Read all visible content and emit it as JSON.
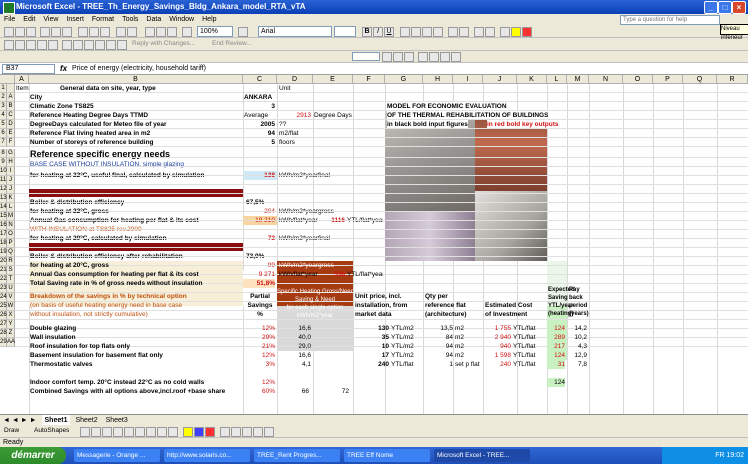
{
  "window": {
    "title": "Microsoft Excel - TREE_Th_Energy_Savings_Bldg_Ankara_model_RTA_vTA",
    "ask_placeholder": "Type a question for help",
    "tooltip": "Niveau inférieur"
  },
  "menu": [
    "File",
    "Edit",
    "View",
    "Insert",
    "Format",
    "Tools",
    "Data",
    "Window",
    "Help"
  ],
  "toolbar": {
    "zoom": "100%",
    "font": "Arial",
    "reply_label": "Reply with Changes...",
    "end_review": "End Review..."
  },
  "formula_bar": {
    "cell_ref": "B37",
    "fx": "fx",
    "content": "Price of energy (electricity, household tariff)"
  },
  "columns": [
    "A",
    "B",
    "C",
    "D",
    "E",
    "F",
    "G",
    "H",
    "I",
    "J",
    "K",
    "L",
    "M",
    "N",
    "O",
    "P",
    "Q",
    "R"
  ],
  "rows": [
    {
      "n": "1",
      "l": ""
    },
    {
      "n": "2",
      "l": "A"
    },
    {
      "n": "3",
      "l": "B"
    },
    {
      "n": "4",
      "l": "C"
    },
    {
      "n": "5",
      "l": "D"
    },
    {
      "n": "6",
      "l": "E"
    },
    {
      "n": "7",
      "l": "F"
    },
    {
      "n": "8",
      "l": "G"
    },
    {
      "n": "9",
      "l": "H"
    },
    {
      "n": "10",
      "l": "I"
    },
    {
      "n": "11",
      "l": "J"
    },
    {
      "n": "12",
      "l": "J"
    },
    {
      "n": "13",
      "l": "K"
    },
    {
      "n": "14",
      "l": "L"
    },
    {
      "n": "15",
      "l": "M"
    },
    {
      "n": "16",
      "l": "N"
    },
    {
      "n": "17",
      "l": "O"
    },
    {
      "n": "18",
      "l": "P"
    },
    {
      "n": "19",
      "l": "Q"
    },
    {
      "n": "20",
      "l": "R"
    },
    {
      "n": "21",
      "l": "S"
    },
    {
      "n": "22",
      "l": "T"
    },
    {
      "n": "23",
      "l": "U"
    },
    {
      "n": "24",
      "l": "V"
    },
    {
      "n": "25",
      "l": "W"
    },
    {
      "n": "26",
      "l": "X"
    },
    {
      "n": "27",
      "l": "Y"
    },
    {
      "n": "28",
      "l": "Z"
    },
    {
      "n": "29",
      "l": "AA"
    }
  ],
  "sheet": {
    "r1": {
      "item": "Item",
      "general": "General data on site, year, type",
      "unit": "Unit"
    },
    "r2": {
      "label": "City",
      "value": "ANKARA"
    },
    "r3": {
      "label": "Climatic Zone TS825",
      "value": "3"
    },
    "r4": {
      "label": "Reference Heating Degree Days TTMD",
      "value": "Average",
      "value2": "2913",
      "unit": "Degree Days"
    },
    "r5": {
      "label": "DegreeDays calculated for Meteo file of year",
      "value": "2005",
      "unit": "??"
    },
    "r6": {
      "label": "Reference Flat living heated area in m2",
      "value": "94",
      "unit": "m2/flat"
    },
    "r7": {
      "label": "Number of storeys of reference building",
      "value": "5",
      "unit": "floors"
    },
    "r8": {
      "label": "Reference specific energy needs"
    },
    "r9": {
      "label": "BASE CASE WITHOUT INSULATION, simple glazing"
    },
    "r10": {
      "label": "for heating at 22°C, useful final, calculated by simulation",
      "value": "138",
      "unit": "kWh/m2*year",
      "note": "final"
    },
    "r12": {
      "label": "Boiler & distribution efficiency",
      "value": "67,5%"
    },
    "r13": {
      "label": "for heating at 22°C, gross",
      "value": "204",
      "unit": "kWh/m2*year",
      "note": "gross"
    },
    "r14": {
      "label": "Annual Gas consumption for heating per flat & its cost",
      "value": "19 210",
      "unit": "kWh/flat*year",
      "value2": "1116",
      "unit2": "YTL/flat*year"
    },
    "r15": {
      "label": "WITH INSULATION at TS825 rev.2000"
    },
    "r16": {
      "label": "for heating at 20°C, calculated by simulation",
      "value": "72",
      "unit": "kWh/m2*year",
      "note": "final"
    },
    "r18": {
      "label": "Boiler & distribution efficiency after rehabilitation",
      "value": "73,0%"
    },
    "r19": {
      "label": "for heating at 20°C, gross",
      "value": "99",
      "unit": "kWh/m2*year",
      "note": "gross"
    },
    "r20": {
      "label": "Annual Gas consumption for heating per flat & its cost",
      "value": "9 271",
      "unit": "kWh/flat*year",
      "value2": "538",
      "unit2": "YTL/flat*year"
    },
    "r21": {
      "label": "Total Saving rate in % of gross needs without insulation",
      "value": "51,8%"
    },
    "hdr": {
      "breakdown": "Breakdown of the savings in % by technical option",
      "breakdown2": "(on basis of useful heating energy need in base case",
      "breakdown3": "without insulation, not strictly cumulative)",
      "partial": "Partial",
      "savings": "Savings",
      "pct": "%",
      "specific": "Specific Heating Gross/Need",
      "saving": "Saving & Need",
      "each": "for each single option",
      "unit_kwh": "kWh/m2*year",
      "unitprice": "Unit price, incl.",
      "installation": "installation, from",
      "market": "market data",
      "qty": "Qty per",
      "ref": "reference flat",
      "architecture": "(architecture)",
      "estcost": "Estimated Cost",
      "ofinv": "of Investment",
      "expected": "Expected",
      "savingL": "Saving",
      "ytl": "YTL/year",
      "heating": "(heating)",
      "pay": "Pay",
      "back": "back",
      "period": "period",
      "years": "(years)"
    },
    "options": [
      {
        "name": "Double glazing",
        "pct": "12%",
        "v1": "16,6",
        "v2": "",
        "price": "130",
        "punit": "YTL/m2",
        "qty": "13,5",
        "qunit": "m2",
        "cost": "1 755",
        "cunit": "YTL/flat",
        "save": "124",
        "pay": "14,2"
      },
      {
        "name": "Wall insulation",
        "pct": "29%",
        "v1": "40,0",
        "v2": "",
        "price": "35",
        "punit": "YTL/m2",
        "qty": "84",
        "qunit": "m2",
        "cost": "2 940",
        "cunit": "YTL/flat",
        "save": "289",
        "pay": "10,2"
      },
      {
        "name": "Roof insulation for top flats only",
        "pct": "21%",
        "v1": "29,0",
        "v2": "",
        "price": "10",
        "punit": "YTL/m2",
        "qty": "94",
        "qunit": "m2",
        "cost": "940",
        "cunit": "YTL/flat",
        "save": "217",
        "pay": "4,3"
      },
      {
        "name": "Basement insulation for basement flat only",
        "pct": "12%",
        "v1": "16,6",
        "v2": "",
        "price": "17",
        "punit": "YTL/m2",
        "qty": "94",
        "qunit": "m2",
        "cost": "1 598",
        "cunit": "YTL/flat",
        "save": "124",
        "pay": "12,9"
      },
      {
        "name": "Thermostatic valves",
        "pct": "3%",
        "v1": "4,1",
        "v2": "",
        "price": "240",
        "punit": "YTL/flat",
        "qty": "1",
        "qunit": "set p flat",
        "cost": "240",
        "cunit": "YTL/flat",
        "save": "31",
        "pay": "7,8"
      }
    ],
    "r28": {
      "label": "Indoor comfort temp. 20°C instead 22°C as no cold walls",
      "pct": "12%",
      "save": "124"
    },
    "r29": {
      "label": "Combined Savings with all options above,incl.roof +base share",
      "pct": "60%",
      "v1": "66",
      "v2": "72"
    },
    "model": {
      "t1": "MODEL FOR ECONOMIC EVALUATION",
      "t2": "OF THE THERMAL REHABILITATION OF BUILDINGS",
      "t3": "in black bold input figures",
      "t4": "in red bold key outputs"
    }
  },
  "sheet_tabs": [
    "Sheet1",
    "Sheet2",
    "Sheet3"
  ],
  "draw_bar": {
    "draw": "Draw",
    "autoshapes": "AutoShapes"
  },
  "status": "Ready",
  "taskbar": {
    "start": "démarrer",
    "tasks": [
      "Messagerie - Orange ...",
      "http://www.solaris.co...",
      "TREE_Rent Progres...",
      "TREE Eff Nome",
      "Microsoft Excel - TREE..."
    ],
    "clock": "FR  19:02"
  }
}
